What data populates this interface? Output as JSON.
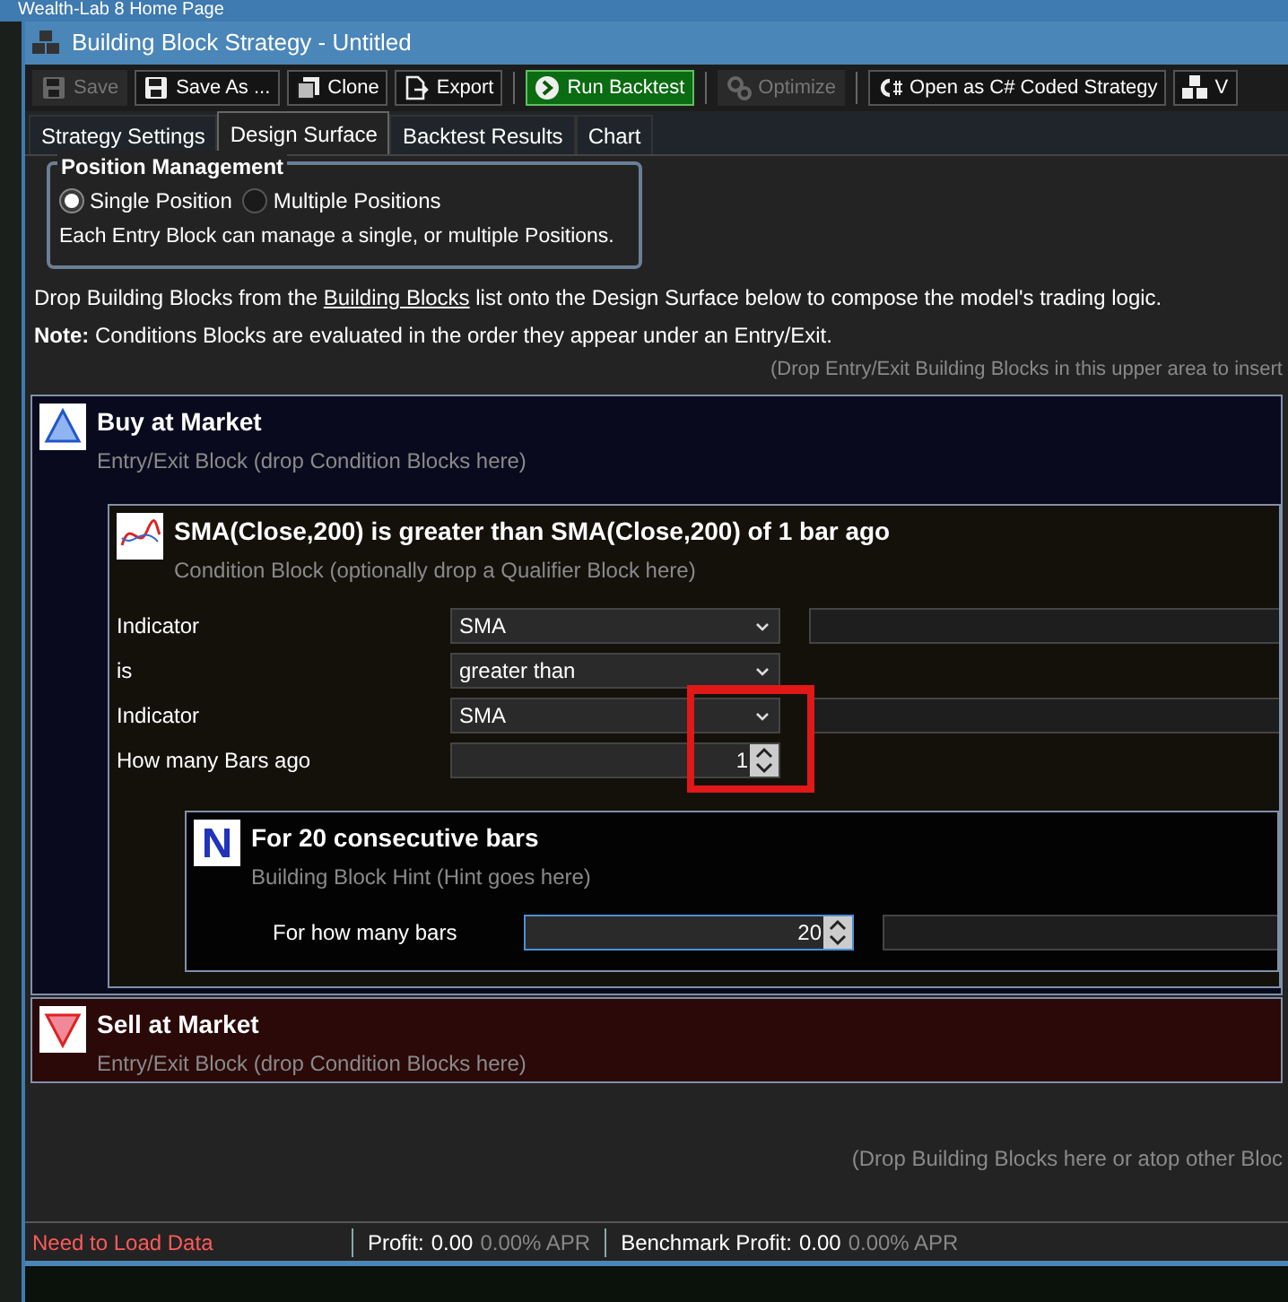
{
  "background_window": {
    "title": "Wealth-Lab 8 Home Page"
  },
  "window": {
    "title": "Building Block Strategy - Untitled"
  },
  "toolbar": [
    {
      "kind": "save",
      "label": "Save",
      "disabled": true
    },
    {
      "kind": "saveas",
      "label": "Save As ...",
      "disabled": false
    },
    {
      "kind": "clone",
      "label": "Clone",
      "disabled": false
    },
    {
      "kind": "export",
      "label": "Export",
      "disabled": false
    },
    {
      "kind": "run",
      "label": "Run Backtest",
      "disabled": false
    },
    {
      "kind": "optimize",
      "label": "Optimize",
      "disabled": true
    },
    {
      "kind": "csharp",
      "label": "Open as C# Coded Strategy",
      "disabled": false
    },
    {
      "kind": "blocks",
      "label": "V",
      "disabled": false
    }
  ],
  "tabs": [
    {
      "label": "Strategy Settings",
      "selected": false
    },
    {
      "label": "Design Surface",
      "selected": true
    },
    {
      "label": "Backtest Results",
      "selected": false
    },
    {
      "label": "Chart",
      "selected": false
    }
  ],
  "position_management": {
    "title": "Position Management",
    "options": [
      {
        "label": "Single Position",
        "selected": true
      },
      {
        "label": "Multiple Positions",
        "selected": false
      }
    ],
    "note": "Each Entry Block can manage a single, or multiple Positions."
  },
  "instructions": {
    "before": "Drop Building Blocks from the ",
    "link": "Building Blocks",
    "after": " list onto the Design Surface below to compose the model's trading logic.",
    "note": "**Note:** Conditions Blocks are evaluated in the order they appear under an Entry/Exit."
  },
  "upper_hint": "(Drop Entry/Exit Building Blocks in this upper area to insert",
  "entry_block": {
    "title": "Buy at Market",
    "subtitle": "Entry/Exit Block (drop Condition Blocks here)",
    "condition": {
      "title": "SMA(Close,200) is greater than SMA(Close,200) of 1 bar ago",
      "subtitle": "Condition Block (optionally drop a Qualifier Block here)",
      "params": [
        {
          "label": "Indicator",
          "kind": "dropdown",
          "value": "SMA",
          "extra_field": true
        },
        {
          "label": "is",
          "kind": "dropdown",
          "value": "greater than",
          "extra_field": false
        },
        {
          "label": "Indicator",
          "kind": "dropdown",
          "value": "SMA",
          "extra_field": true
        },
        {
          "label": "How many Bars ago",
          "kind": "spinner",
          "value": "1",
          "extra_field": false
        }
      ],
      "qualifier": {
        "title": "For 20 consecutive bars",
        "subtitle": "Building Block Hint (Hint goes here)",
        "params": [
          {
            "label": "For how many bars",
            "kind": "spinner",
            "value": "20",
            "extra_field": true,
            "focused": true
          }
        ]
      }
    }
  },
  "exit_block": {
    "title": "Sell at Market",
    "subtitle": "Entry/Exit Block (drop Condition Blocks here)"
  },
  "lower_hint": "(Drop Building Blocks here or atop other Bloc",
  "status_bar": {
    "data_status": "Need to Load Data",
    "profit_label": "Profit:",
    "profit": "0.00",
    "profit_apr": "0.00% APR",
    "benchmark_label": "Benchmark Profit:",
    "benchmark": "0.00",
    "benchmark_apr": "0.00% APR"
  }
}
